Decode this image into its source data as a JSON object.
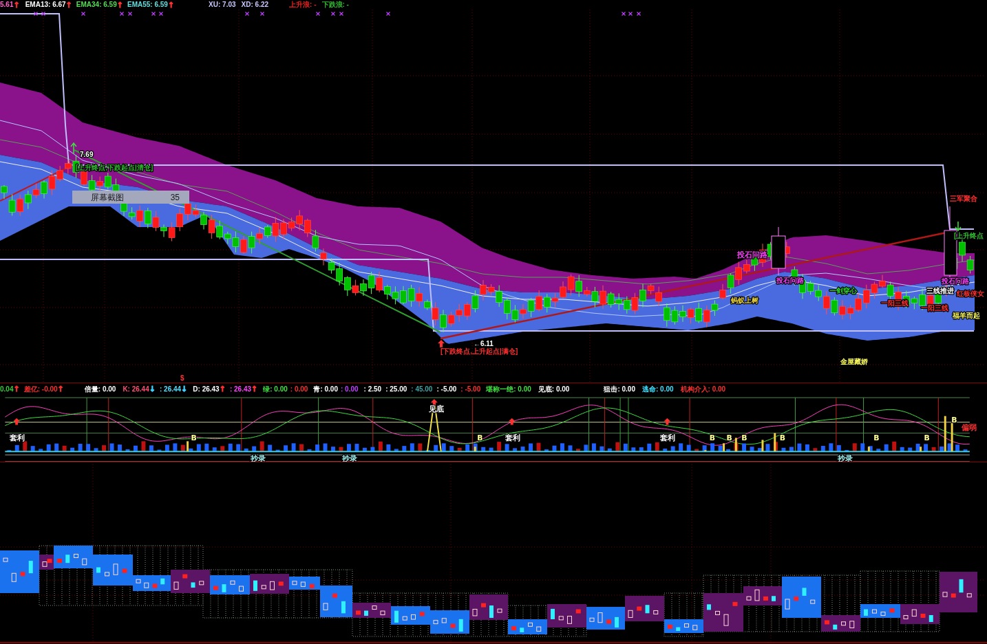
{
  "price_legend": [
    {
      "text": "5.61",
      "color": "#ff66cc",
      "arrow": {
        "text": "↑",
        "color": "#ff3030"
      }
    },
    {
      "text": "EMA13: 6.67",
      "color": "#ffffff",
      "arrow": {
        "text": "↑",
        "color": "#ff3030"
      }
    },
    {
      "text": "EMA34: 6.59",
      "color": "#55dd55",
      "arrow": {
        "text": "↑",
        "color": "#ff3030"
      }
    },
    {
      "text": "EMA55: 6.59",
      "color": "#66dddd",
      "arrow": {
        "text": "↑",
        "color": "#ff3030"
      }
    },
    {
      "text": "XU: 7.03",
      "color": "#c8c8ff"
    },
    {
      "text": "XD: 6.22",
      "color": "#c8c8ff"
    },
    {
      "text": "上升浪: -",
      "color": "#ee2222"
    },
    {
      "text": "下跌浪: -",
      "color": "#33bb33"
    }
  ],
  "price_chart": {
    "annotations": [
      {
        "text": "7.69",
        "color": "#ffffff"
      },
      {
        "text": "[上升终点,下跌起点|清仓]",
        "color": "#30c030"
      },
      {
        "text": "三军聚合",
        "color": "#ff3030"
      },
      {
        "text": "[上升终点",
        "color": "#30c030"
      },
      {
        "text": "投石问路",
        "color": "#ff40ff"
      },
      {
        "text": "投石问路",
        "color": "#ff40ff"
      },
      {
        "text": "投石问路",
        "color": "#ff40ff"
      },
      {
        "text": "一剑穿心",
        "color": "#30e030"
      },
      {
        "text": "三线推进",
        "color": "#ffffff"
      },
      {
        "text": "红板侠女",
        "color": "#ff3030"
      },
      {
        "text": "蚂蚁上树",
        "color": "#f0d840"
      },
      {
        "text": "一阳三线",
        "color": "#ff3030"
      },
      {
        "text": "一阳三线",
        "color": "#ff3030"
      },
      {
        "text": "福羊而起",
        "color": "#ffff60"
      },
      {
        "text": "←6.11",
        "color": "#ffffff"
      },
      {
        "text": "[下跌终点,上升起点|满仓]",
        "color": "#ff3030"
      },
      {
        "text": "金屋藏娇",
        "color": "#ffff60"
      },
      {
        "text": "$",
        "color": "#ff3030"
      }
    ],
    "popup": {
      "title": "屏幕截图",
      "value": "35"
    }
  },
  "indicator_legend": [
    {
      "text": "0.04",
      "color": "#33cc33",
      "arrow": {
        "text": "↑",
        "color": "#ff3030"
      }
    },
    {
      "text": "差亿: -0.00",
      "color": "#ff3030",
      "arrow": {
        "text": "↑",
        "color": "#ff3030"
      }
    },
    {
      "text": "倍量: 0.00",
      "color": "#ffffff"
    },
    {
      "text": "K: 26.44",
      "color": "#ff5070",
      "arrow": {
        "text": "↓",
        "color": "#40d0ff"
      }
    },
    {
      "text": ": 26.44",
      "color": "#50e0ff",
      "arrow": {
        "text": "↓",
        "color": "#40d0ff"
      }
    },
    {
      "text": "D: 26.43",
      "color": "#ffffff",
      "arrow": {
        "text": "↑",
        "color": "#ff3030"
      }
    },
    {
      "text": ": 26.43",
      "color": "#ff40ff",
      "arrow": {
        "text": "↑",
        "color": "#ff3030"
      }
    },
    {
      "text": "绿: 0.00",
      "color": "#40e040"
    },
    {
      "text": ": 0.00",
      "color": "#ff3030"
    },
    {
      "text": "青: 0.00",
      "color": "#ffffff"
    },
    {
      "text": ": 0.00",
      "color": "#c040ff"
    },
    {
      "text": ": 2.50",
      "color": "#ffffff"
    },
    {
      "text": ": 25.00",
      "color": "#ffffff"
    },
    {
      "text": ": 45.00",
      "color": "#40a0a0"
    },
    {
      "text": ": -5.00",
      "color": "#ffffff"
    },
    {
      "text": ": -5.00",
      "color": "#ff3030"
    },
    {
      "text": "堪称一绝: 0.00",
      "color": "#40e040"
    },
    {
      "text": "见底: 0.00",
      "color": "#ffffff"
    },
    {
      "text": "狙击: 0.00",
      "color": "#ffffff"
    },
    {
      "text": "逃命: 0.00",
      "color": "#40e0ff"
    },
    {
      "text": "机构介入: 0.00",
      "color": "#ff3030"
    }
  ],
  "indicator_chart": {
    "labels": [
      {
        "text": "见底",
        "color": "#ffffff"
      },
      {
        "text": "B",
        "color": "#ffff99"
      },
      {
        "text": "偏弱",
        "color": "#ff3030"
      },
      {
        "text": "套利",
        "color": "#ffffff"
      },
      {
        "text": "B",
        "color": "#ffff99"
      },
      {
        "text": "B",
        "color": "#ffff99"
      },
      {
        "text": "套利",
        "color": "#ffffff"
      },
      {
        "text": "套利",
        "color": "#ffffff"
      },
      {
        "text": "B",
        "color": "#ffff99"
      },
      {
        "text": "B",
        "color": "#ffff99"
      },
      {
        "text": "B",
        "color": "#ffff99"
      },
      {
        "text": "B",
        "color": "#ffff99"
      },
      {
        "text": "B",
        "color": "#ffff99"
      },
      {
        "text": "B",
        "color": "#ffff99"
      },
      {
        "text": "抄录",
        "color": "#a0f0f0"
      },
      {
        "text": "抄录",
        "color": "#a0f0f0"
      },
      {
        "text": "抄录",
        "color": "#a0f0f0"
      }
    ]
  }
}
